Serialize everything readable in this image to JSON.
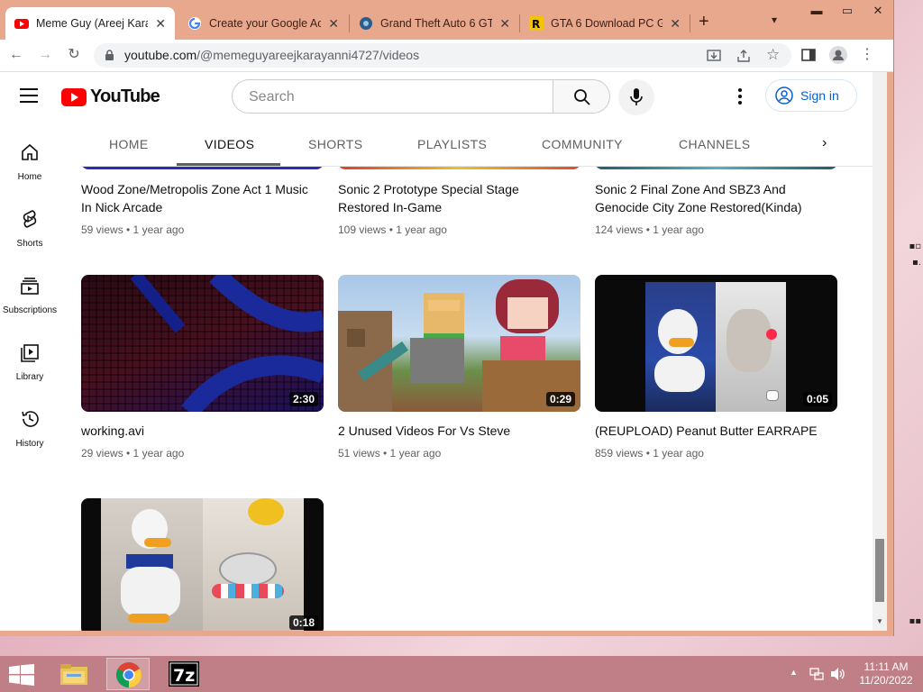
{
  "browser": {
    "tabs": [
      {
        "title": "Meme Guy (Areej Karay",
        "active": true
      },
      {
        "title": "Create your Google Acc",
        "active": false
      },
      {
        "title": "Grand Theft Auto 6 GTA",
        "active": false
      },
      {
        "title": "GTA 6 Download PC Ga",
        "active": false
      }
    ],
    "new_tab": "+",
    "url_host": "youtube.com",
    "url_path": "/@memeguyareejkarayanni4727/videos"
  },
  "youtube": {
    "logo_text": "YouTube",
    "search_placeholder": "Search",
    "sign_in": "Sign in",
    "sidebar": [
      {
        "label": "Home"
      },
      {
        "label": "Shorts"
      },
      {
        "label": "Subscriptions"
      },
      {
        "label": "Library"
      },
      {
        "label": "History"
      }
    ],
    "channel_tabs": [
      "HOME",
      "VIDEOS",
      "SHORTS",
      "PLAYLISTS",
      "COMMUNITY",
      "CHANNELS"
    ],
    "active_tab": "VIDEOS",
    "videos": [
      {
        "title": "Wood Zone/Metropolis Zone Act 1 Music In Nick Arcade",
        "meta": "59 views • 1 year ago"
      },
      {
        "title": "Sonic 2 Prototype Special Stage Restored In-Game",
        "meta": "109 views • 1 year ago"
      },
      {
        "title": "Sonic 2 Final Zone And SBZ3 And Genocide City Zone Restored(Kinda)",
        "meta": "124 views • 1 year ago"
      },
      {
        "title": "working.avi",
        "meta": "29 views • 1 year ago",
        "duration": "2:30"
      },
      {
        "title": "2 Unused Videos For Vs Steve",
        "meta": "51 views • 1 year ago",
        "duration": "0:29"
      },
      {
        "title": "(REUPLOAD) Peanut Butter EARRAPE",
        "meta": "859 views • 1 year ago",
        "duration": "0:05"
      },
      {
        "duration": "0:18"
      }
    ]
  },
  "taskbar": {
    "time": "11:11 AM",
    "date": "11/20/2022"
  },
  "colors": {
    "chrome_frame": "#e8a88e",
    "yt_red": "#ff0000",
    "link_blue": "#065fd4",
    "taskbar": "#c07e86"
  }
}
